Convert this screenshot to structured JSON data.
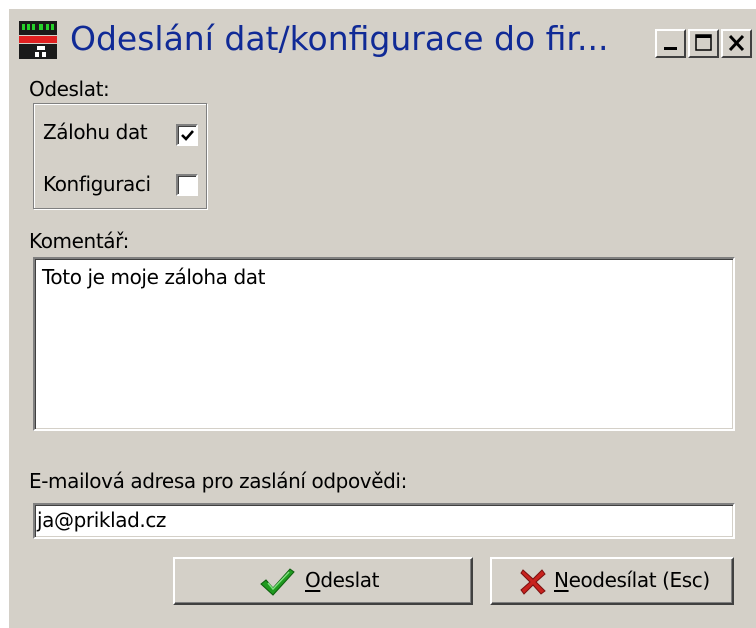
{
  "window": {
    "title": "Odeslání dat/konfigurace do fir..."
  },
  "send_section": {
    "label": "Odeslat:",
    "backup_label": "Zálohu dat",
    "backup_checked": true,
    "config_label": "Konfiguraci",
    "config_checked": false
  },
  "comment": {
    "label": "Komentář:",
    "value": "Toto je moje záloha dat"
  },
  "email": {
    "label": "E-mailová adresa pro zaslání odpovědi:",
    "value": "ja@priklad.cz"
  },
  "buttons": {
    "send_label_first": "O",
    "send_label_rest": "deslat",
    "cancel_label_first": "N",
    "cancel_label_rest": "eodesílat (Esc)"
  },
  "icons": {
    "app": "app-icon",
    "send": "checkmark-icon",
    "cancel": "cross-icon"
  },
  "colors": {
    "title_text": "#102a96",
    "window_bg": "#d4d0c8",
    "check_green": "#1f9a1f",
    "cross_red": "#c8221e"
  }
}
